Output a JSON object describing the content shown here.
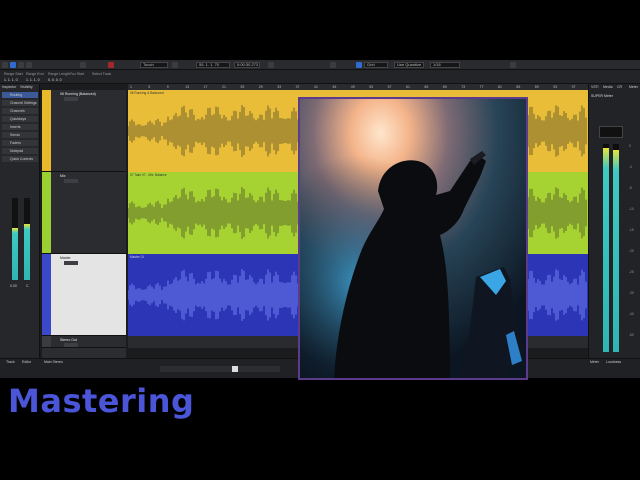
{
  "toolbar": {
    "quantize_label": "Touch",
    "timecode": "55. 1. 1. 70",
    "time_display": "0:00:30.273",
    "grid_label": "Grid",
    "quantize_type": "Use Quantize",
    "quantize_value": "1/16"
  },
  "infoline": {
    "fields": [
      {
        "label": "Range Start",
        "value": "1. 1. 1. 0"
      },
      {
        "label": "Range End",
        "value": "1. 1. 1. 0"
      },
      {
        "label": "Range Length",
        "value": "0. 0. 0. 0"
      },
      {
        "label": "Fuz Start",
        "value": ""
      },
      {
        "label": "Select Track",
        "value": ""
      }
    ]
  },
  "inspector": {
    "tabs": [
      "Inspector",
      "Visibility"
    ],
    "rows": [
      "Routing",
      "Channel Settings",
      "Channels",
      "Quickkeys",
      "Inserts",
      "Sends",
      "Faders",
      "Notepad",
      "Quick Controls"
    ],
    "fader_value": "0.00",
    "pan_value": "C"
  },
  "tracks": [
    {
      "name": "06 Running (Balanced)",
      "color": "#e8b92a",
      "lane_color": "#e9bd38",
      "clip_title": "06 Running & Balanced"
    },
    {
      "name": "Mix",
      "color": "#9ad02f",
      "lane_color": "#a7d332",
      "clip_title": "07 Take 07 - Mix, Balance"
    },
    {
      "name": "Master",
      "color": "#3a49c9",
      "lane_color": "#2b35b6",
      "clip_title": "Master 01"
    },
    {
      "name": "Stereo Out",
      "color": "#3a3c42",
      "lane_color": "#2a2b2e",
      "clip_title": ""
    }
  ],
  "ruler": {
    "marks": [
      "1",
      "5",
      "9",
      "13",
      "17",
      "21",
      "25",
      "29",
      "33",
      "37",
      "41",
      "45",
      "49",
      "53",
      "57",
      "61",
      "65",
      "69",
      "73",
      "77",
      "81",
      "85",
      "89",
      "93",
      "97"
    ]
  },
  "meter_panel": {
    "tabs": [
      "VSTi",
      "Media",
      "CR",
      "Meter"
    ],
    "header": "SUPER Meter",
    "scale": [
      "0",
      "-3",
      "-6",
      "-10",
      "-15",
      "-20",
      "-25",
      "-30",
      "-40",
      "-50"
    ],
    "readout_labels": [
      "RMS Max",
      "Peak Max"
    ],
    "readout_values": [
      "-8.8",
      "-0.1"
    ],
    "bottom_tabs": [
      "Meter",
      "Loudness"
    ]
  },
  "bottom_bar": {
    "tabs": [
      "Track",
      "Editor"
    ],
    "status": "Main Stereo"
  },
  "title": "Mastering",
  "colors": {
    "title": "#4a55d8",
    "accent": "#3c5a9a",
    "meter": "#2fb5b4",
    "photo_border": "#5c3a8c"
  }
}
